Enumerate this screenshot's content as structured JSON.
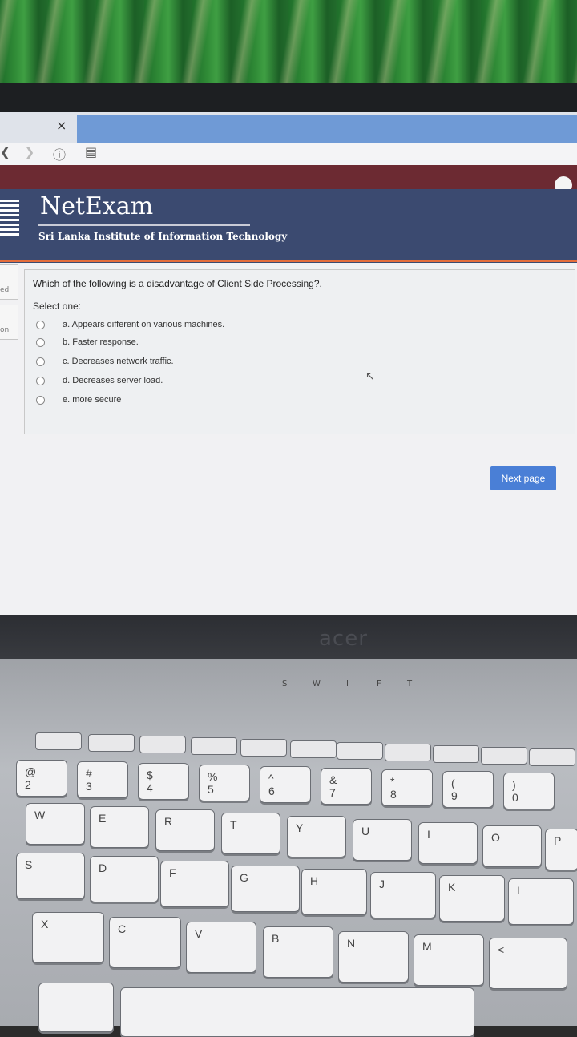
{
  "browser": {
    "tab_close": "×",
    "toolbar_icons": [
      "back-icon",
      "forward-icon",
      "info-icon",
      "reader-icon"
    ]
  },
  "site": {
    "brand": "NetExam",
    "tagline": "Sri Lanka Institute of Information Technology",
    "side_tabs": [
      "ed",
      "on"
    ]
  },
  "quiz": {
    "question": "Which of the following is a disadvantage of Client Side Processing?.",
    "prompt": "Select one:",
    "options": [
      "a. Appears different on various machines.",
      "b. Faster response.",
      "c. Decreases network traffic.",
      "d. Decreases server load.",
      "e. more secure"
    ],
    "next_button": "Next page"
  },
  "laptop": {
    "speaker_letters": [
      "S",
      "W",
      "I",
      "F",
      "T"
    ],
    "number_row": [
      "2",
      "3",
      "4",
      "5",
      "6",
      "7",
      "8",
      "9",
      "0"
    ],
    "number_row_symbols": [
      "@",
      "#",
      "$",
      "%",
      "^",
      "&",
      "*",
      "(",
      ")"
    ],
    "qwerty_row": [
      "W",
      "E",
      "R",
      "T",
      "Y",
      "U",
      "I",
      "O",
      "P"
    ],
    "home_row": [
      "S",
      "D",
      "F",
      "G",
      "H",
      "J",
      "K",
      "L"
    ],
    "bottom_row": [
      "X",
      "C",
      "V",
      "B",
      "N",
      "M",
      "<"
    ]
  }
}
